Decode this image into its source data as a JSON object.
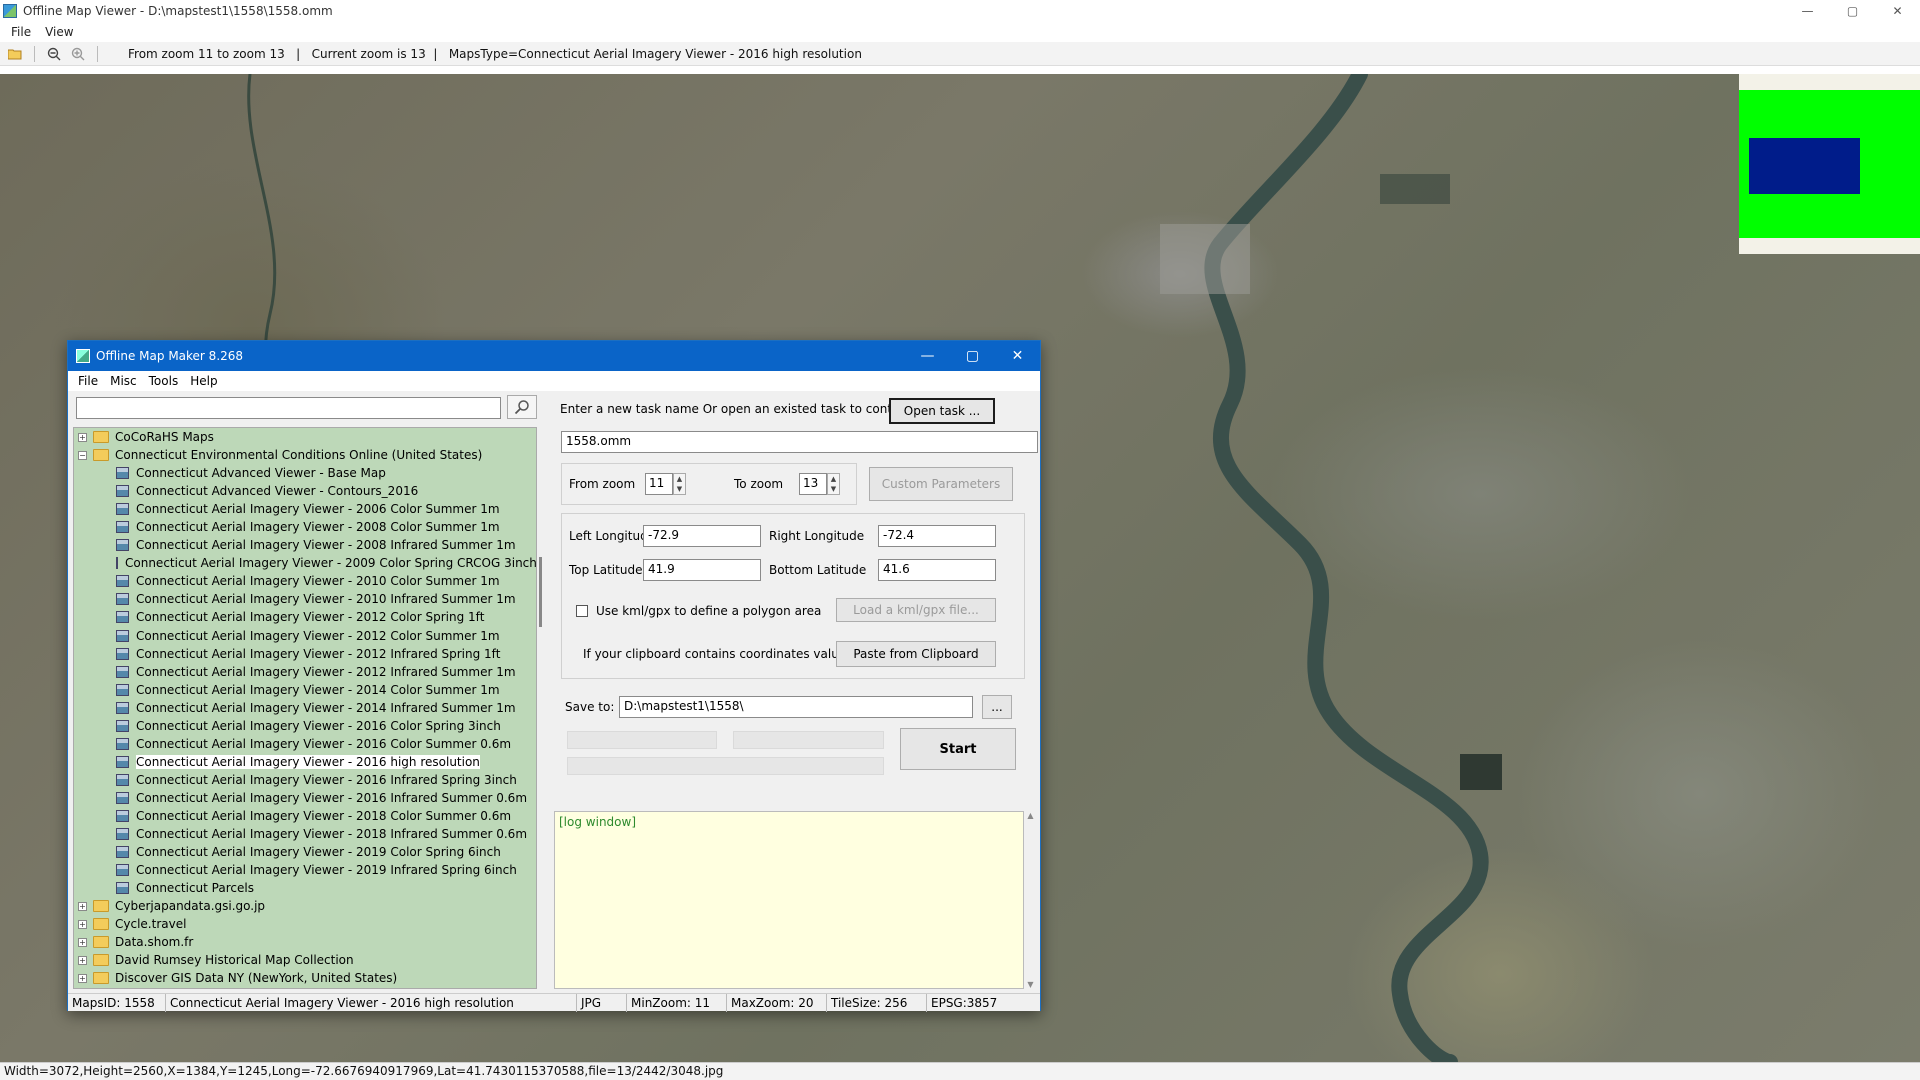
{
  "window": {
    "title": "Offline Map Viewer - D:\\mapstest1\\1558\\1558.omm"
  },
  "window_controls": {
    "minimize": "—",
    "maximize": "▢",
    "close": "✕"
  },
  "menubar": {
    "file": "File",
    "view": "View"
  },
  "toolbar": {
    "icons": [
      "open-folder-icon",
      "zoom-out-icon",
      "zoom-in-icon"
    ],
    "info": "From zoom 11 to zoom 13   |   Current zoom is 13  |   MapsType=Connecticut Aerial Imagery Viewer - 2016 high resolution"
  },
  "statusbar": {
    "text": "Width=3072,Height=2560,X=1384,Y=1245,Long=-72.6676940917969,Lat=41.7430115370588,file=13/2442/3048.jpg"
  },
  "dialog": {
    "title": "Offline Map Maker 8.268",
    "menu": {
      "file": "File",
      "misc": "Misc",
      "tools": "Tools",
      "help": "Help"
    },
    "search": {
      "value": ""
    },
    "tree": [
      {
        "type": "folder",
        "expanded": false,
        "label": "CoCoRaHS Maps"
      },
      {
        "type": "folder",
        "expanded": true,
        "label": "Connecticut Environmental Conditions Online (United States)"
      },
      {
        "type": "map",
        "label": "Connecticut Advanced Viewer - Base Map"
      },
      {
        "type": "map",
        "label": "Connecticut Advanced Viewer - Contours_2016"
      },
      {
        "type": "map",
        "label": "Connecticut Aerial Imagery Viewer - 2006 Color Summer 1m"
      },
      {
        "type": "map",
        "label": "Connecticut Aerial Imagery Viewer - 2008 Color Summer 1m"
      },
      {
        "type": "map",
        "label": "Connecticut Aerial Imagery Viewer - 2008 Infrared Summer 1m"
      },
      {
        "type": "map",
        "label": "Connecticut Aerial Imagery Viewer - 2009 Color Spring CRCOG 3inch"
      },
      {
        "type": "map",
        "label": "Connecticut Aerial Imagery Viewer - 2010 Color Summer 1m"
      },
      {
        "type": "map",
        "label": "Connecticut Aerial Imagery Viewer - 2010 Infrared Summer 1m"
      },
      {
        "type": "map",
        "label": "Connecticut Aerial Imagery Viewer - 2012 Color Spring 1ft"
      },
      {
        "type": "map",
        "label": "Connecticut Aerial Imagery Viewer - 2012 Color Summer 1m"
      },
      {
        "type": "map",
        "label": "Connecticut Aerial Imagery Viewer - 2012 Infrared Spring 1ft"
      },
      {
        "type": "map",
        "label": "Connecticut Aerial Imagery Viewer - 2012 Infrared Summer 1m"
      },
      {
        "type": "map",
        "label": "Connecticut Aerial Imagery Viewer - 2014 Color Summer 1m"
      },
      {
        "type": "map",
        "label": "Connecticut Aerial Imagery Viewer - 2014 Infrared Summer 1m"
      },
      {
        "type": "map",
        "label": "Connecticut Aerial Imagery Viewer - 2016 Color Spring 3inch"
      },
      {
        "type": "map",
        "label": "Connecticut Aerial Imagery Viewer - 2016 Color Summer 0.6m"
      },
      {
        "type": "map",
        "label": "Connecticut Aerial Imagery Viewer - 2016 high resolution",
        "selected": true
      },
      {
        "type": "map",
        "label": "Connecticut Aerial Imagery Viewer - 2016 Infrared Spring 3inch"
      },
      {
        "type": "map",
        "label": "Connecticut Aerial Imagery Viewer - 2016 Infrared Summer 0.6m"
      },
      {
        "type": "map",
        "label": "Connecticut Aerial Imagery Viewer - 2018 Color Summer 0.6m"
      },
      {
        "type": "map",
        "label": "Connecticut Aerial Imagery Viewer - 2018 Infrared Summer 0.6m"
      },
      {
        "type": "map",
        "label": "Connecticut Aerial Imagery Viewer - 2019 Color Spring 6inch"
      },
      {
        "type": "map",
        "label": "Connecticut Aerial Imagery Viewer - 2019 Infrared Spring 6inch"
      },
      {
        "type": "map",
        "label": "Connecticut Parcels"
      },
      {
        "type": "folder",
        "expanded": false,
        "label": "Cyberjapandata.gsi.go.jp"
      },
      {
        "type": "folder",
        "expanded": false,
        "label": "Cycle.travel"
      },
      {
        "type": "folder",
        "expanded": false,
        "label": "Data.shom.fr"
      },
      {
        "type": "folder",
        "expanded": false,
        "label": "David Rumsey Historical Map Collection"
      },
      {
        "type": "folder",
        "expanded": false,
        "label": "Discover GIS Data NY (NewYork, United States)"
      }
    ],
    "task": {
      "prompt": "Enter a new task name Or open an existed task to continue:",
      "open_button": "Open task ...",
      "name": "1558.omm"
    },
    "zoom": {
      "from_label": "From zoom",
      "from_value": "11",
      "to_label": "To zoom",
      "to_value": "13",
      "custom_button": "Custom Parameters"
    },
    "coords": {
      "left_lon_label": "Left Longitude",
      "left_lon": "-72.9",
      "right_lon_label": "Right Longitude",
      "right_lon": "-72.4",
      "top_lat_label": "Top Latitude",
      "top_lat": "41.9",
      "bottom_lat_label": "Bottom Latitude",
      "bottom_lat": "41.6"
    },
    "kml": {
      "checkbox_label": "Use kml/gpx to define a polygon area",
      "checked": false,
      "load_button": "Load a kml/gpx file..."
    },
    "clipboard": {
      "prompt": "If your clipboard contains coordinates values:",
      "paste_button": "Paste from Clipboard"
    },
    "save": {
      "label": "Save to:",
      "path": "D:\\mapstest1\\1558\\",
      "browse_button": "..."
    },
    "start_button": "Start",
    "log": {
      "text": "[log window]"
    },
    "status": {
      "maps_id": "MapsID: 1558",
      "name": "Connecticut Aerial Imagery Viewer - 2016 high resolution",
      "format": "JPG",
      "min_zoom": "MinZoom: 11",
      "max_zoom": "MaxZoom: 20",
      "tile_size": "TileSize: 256",
      "epsg": "EPSG:3857"
    }
  },
  "colors": {
    "dialog_title": "#0a64c8",
    "tree_bg": "#bdd8b8",
    "log_bg": "#ffffe0",
    "log_text": "#2d8a2d",
    "minimap_green": "#00ff00",
    "minimap_viewport": "#001c8a"
  }
}
